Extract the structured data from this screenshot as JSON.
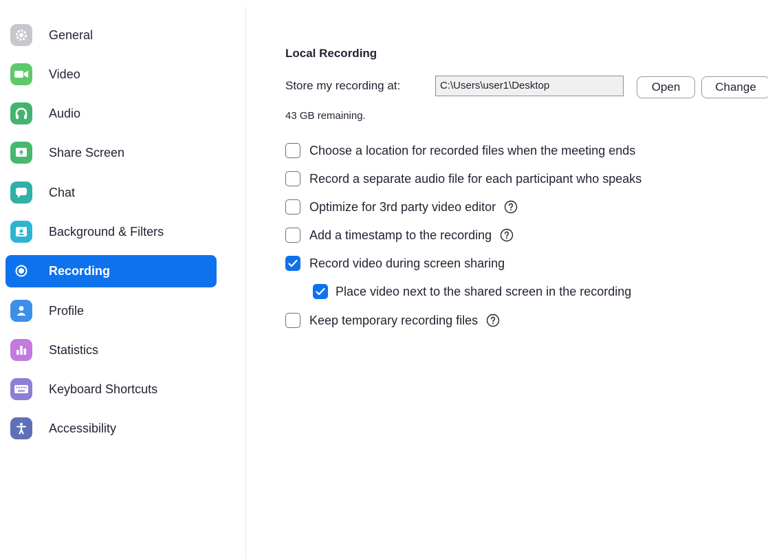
{
  "sidebar": {
    "items": [
      {
        "label": "General",
        "icon": "gear-icon",
        "color": "#b5b5bd",
        "active": false
      },
      {
        "label": "Video",
        "icon": "video-camera-icon",
        "color": "#5ec96b",
        "active": false
      },
      {
        "label": "Audio",
        "icon": "headphones-icon",
        "color": "#44b36f",
        "active": false
      },
      {
        "label": "Share Screen",
        "icon": "share-screen-icon",
        "color": "#47b86e",
        "active": false
      },
      {
        "label": "Chat",
        "icon": "chat-bubble-icon",
        "color": "#30b0a6",
        "active": false
      },
      {
        "label": "Background & Filters",
        "icon": "background-person-icon",
        "color": "#2cb5cf",
        "active": false
      },
      {
        "label": "Recording",
        "icon": "record-icon",
        "color": "#ffffff",
        "active": true
      },
      {
        "label": "Profile",
        "icon": "person-icon",
        "color": "#3d8fec",
        "active": false
      },
      {
        "label": "Statistics",
        "icon": "bar-chart-icon",
        "color": "#c27ae0",
        "active": false
      },
      {
        "label": "Keyboard Shortcuts",
        "icon": "keyboard-icon",
        "color": "#8b7fd8",
        "active": false
      },
      {
        "label": "Accessibility",
        "icon": "accessibility-icon",
        "color": "#5f6fb8",
        "active": false
      }
    ],
    "active_color": "#0e72ed"
  },
  "main": {
    "section_title": "Local Recording",
    "store_label": "Store my recording at:",
    "path_value": "C:\\Users\\user1\\Desktop",
    "open_label": "Open",
    "change_label": "Change",
    "remaining": "43 GB remaining.",
    "options": [
      {
        "label": "Choose a location for recorded files when the meeting ends",
        "checked": false,
        "help": false
      },
      {
        "label": "Record a separate audio file for each participant who speaks",
        "checked": false,
        "help": false
      },
      {
        "label": "Optimize for 3rd party video editor",
        "checked": false,
        "help": true
      },
      {
        "label": "Add a timestamp to the recording",
        "checked": false,
        "help": true
      },
      {
        "label": "Record video during screen sharing",
        "checked": true,
        "help": false
      },
      {
        "label": "Place video next to the shared screen in the recording",
        "checked": true,
        "help": false
      },
      {
        "label": "Keep temporary recording files",
        "checked": false,
        "help": true
      }
    ]
  }
}
